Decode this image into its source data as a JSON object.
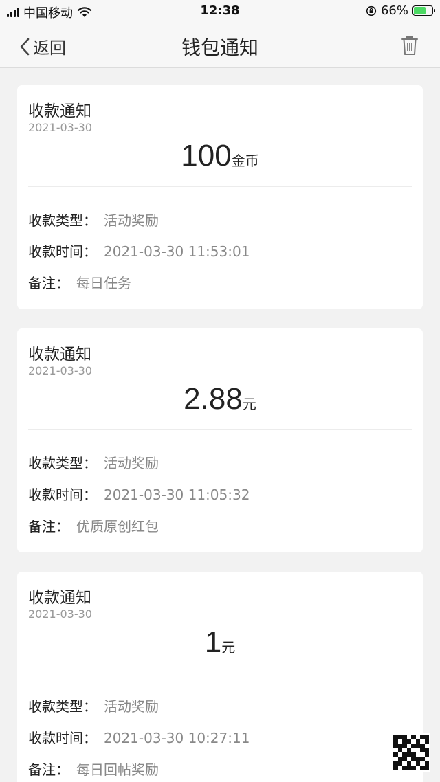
{
  "status_bar": {
    "carrier": "中国移动",
    "time": "12:38",
    "battery_text": "66%",
    "battery_level": 0.66
  },
  "nav": {
    "back_label": "返回",
    "title": "钱包通知"
  },
  "notifications": [
    {
      "title": "收款通知",
      "date": "2021-03-30",
      "amount": "100",
      "unit": "金币",
      "type_label": "收款类型：",
      "type_value": "活动奖励",
      "time_label": "收款时间：",
      "time_value": "2021-03-30 11:53:01",
      "note_label": "备注：",
      "note_value": "每日任务"
    },
    {
      "title": "收款通知",
      "date": "2021-03-30",
      "amount": "2.88",
      "unit": "元",
      "type_label": "收款类型：",
      "type_value": "活动奖励",
      "time_label": "收款时间：",
      "time_value": "2021-03-30 11:05:32",
      "note_label": "备注：",
      "note_value": "优质原创红包"
    },
    {
      "title": "收款通知",
      "date": "2021-03-30",
      "amount": "1",
      "unit": "元",
      "type_label": "收款类型：",
      "type_value": "活动奖励",
      "time_label": "收款时间：",
      "time_value": "2021-03-30 10:27:11",
      "note_label": "备注：",
      "note_value": "每日回帖奖励"
    }
  ],
  "colors": {
    "background": "#f2f2f2",
    "card": "#ffffff",
    "muted_text": "#888888",
    "battery_green": "#4cd964"
  }
}
